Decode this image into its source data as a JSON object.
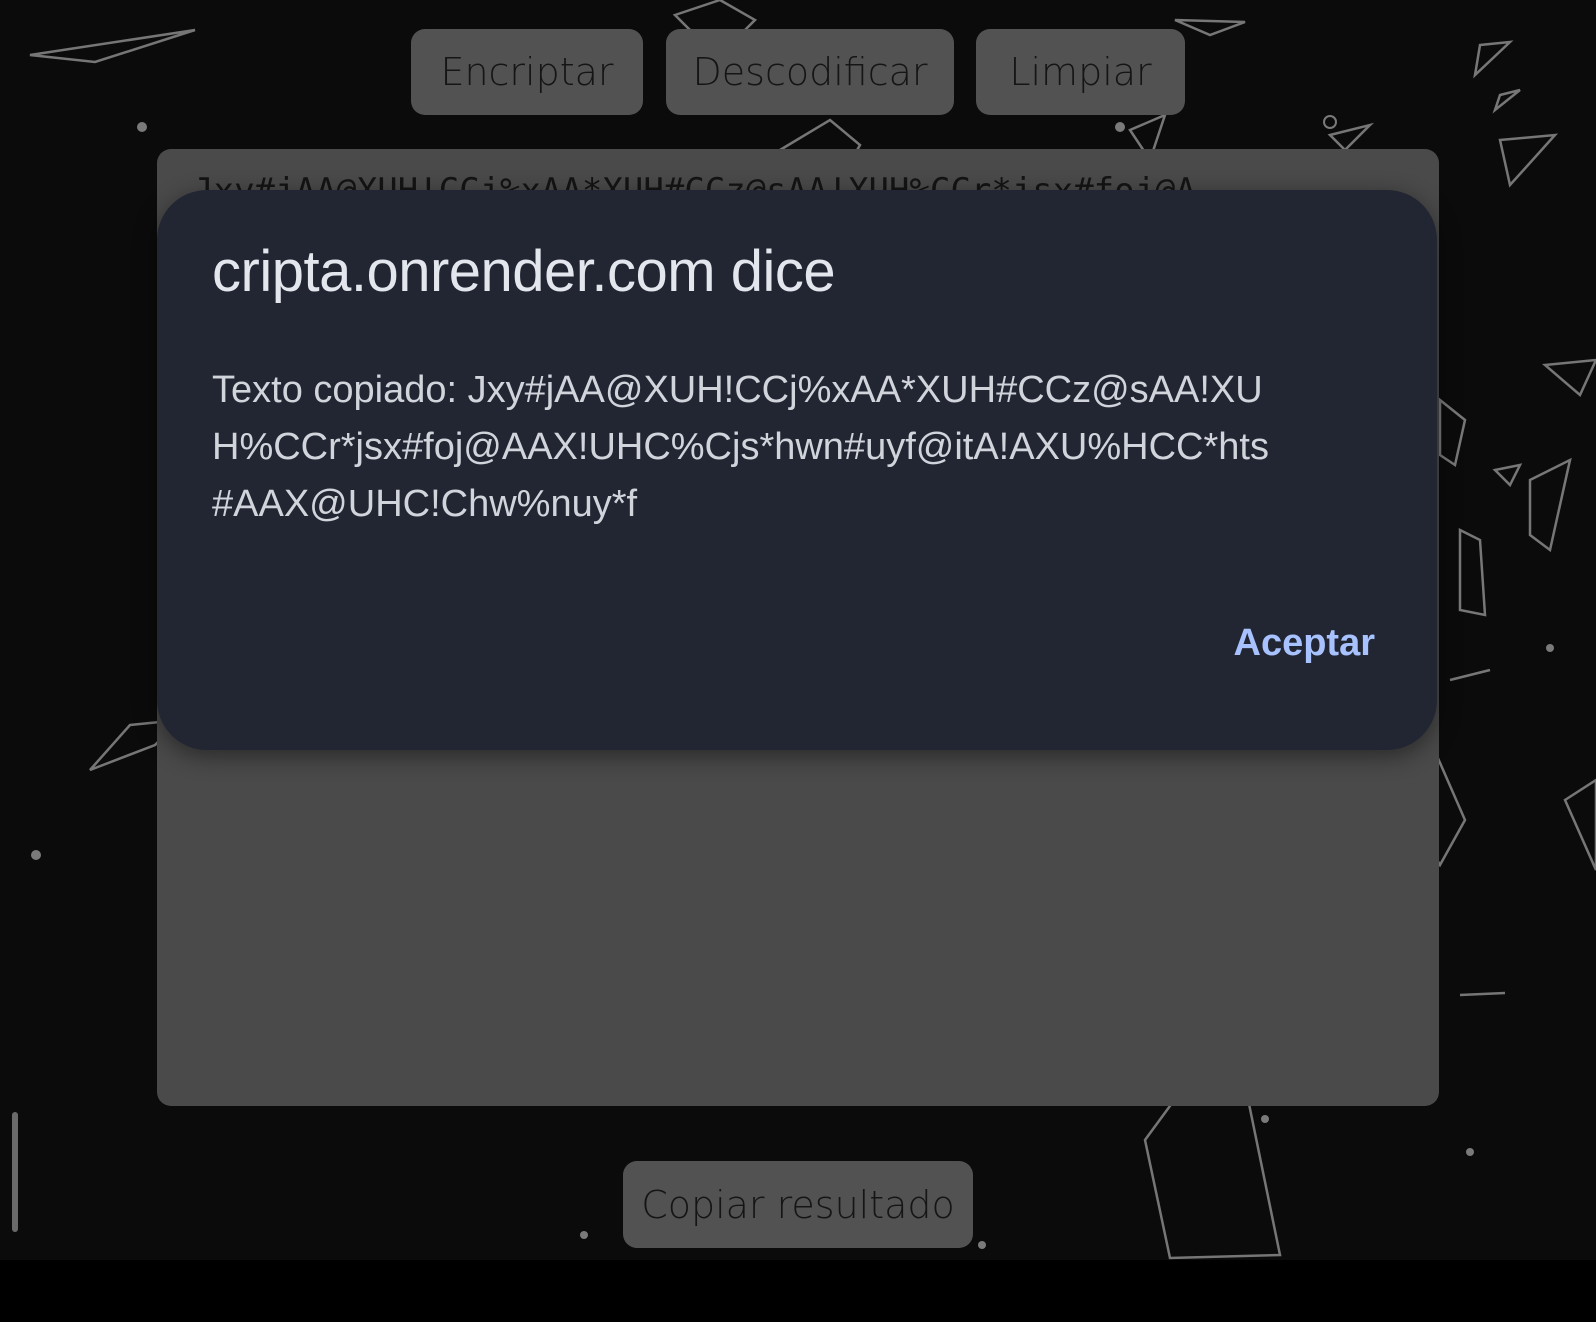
{
  "toolbar": {
    "encrypt_label": "Encriptar",
    "decode_label": "Descodificar",
    "clear_label": "Limpiar"
  },
  "textarea": {
    "value": "Jxy#jAA@XUH!CCj%xAA*XUH#CCz@sAA!XUH%CCr*jsx#foj@A"
  },
  "copy_button": {
    "label": "Copiar resultado"
  },
  "dialog": {
    "title": "cripta.onrender.com dice",
    "message": "Texto copiado: Jxy#jAA@XUH!CCj%xAA*XUH#CCz@sAA!XUH%CCr*jsx#foj@AAX!UHC%Cjs*hwn#uyf@itA!AXU%HCC*hts#AAX@UHC!Chw%nuy*f",
    "ok_label": "Aceptar"
  },
  "colors": {
    "background": "#0b0b0b",
    "button": "#525252",
    "panel": "#4a4a4a",
    "dialog": "#222632",
    "accent": "#a8c2ff"
  }
}
